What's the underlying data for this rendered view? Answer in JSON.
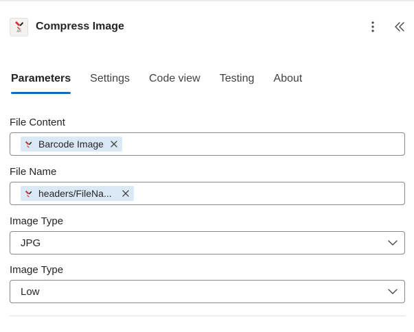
{
  "header": {
    "title": "Compress Image",
    "app_icon": "api4ai-logo-icon",
    "more_icon": "more-vertical-icon",
    "collapse_icon": "double-chevron-left-icon"
  },
  "tabs": [
    {
      "label": "Parameters",
      "active": true
    },
    {
      "label": "Settings",
      "active": false
    },
    {
      "label": "Code view",
      "active": false
    },
    {
      "label": "Testing",
      "active": false
    },
    {
      "label": "About",
      "active": false
    }
  ],
  "fields": {
    "file_content": {
      "label": "File Content",
      "token": "Barcode Image"
    },
    "file_name": {
      "label": "File Name",
      "token": "headers/FileNa..."
    },
    "image_type_1": {
      "label": "Image Type",
      "value": "JPG"
    },
    "image_type_2": {
      "label": "Image Type",
      "value": "Low"
    }
  },
  "colors": {
    "accent": "#0f6cbd",
    "token_bg": "#dbe9f7",
    "border": "#8a8886"
  }
}
